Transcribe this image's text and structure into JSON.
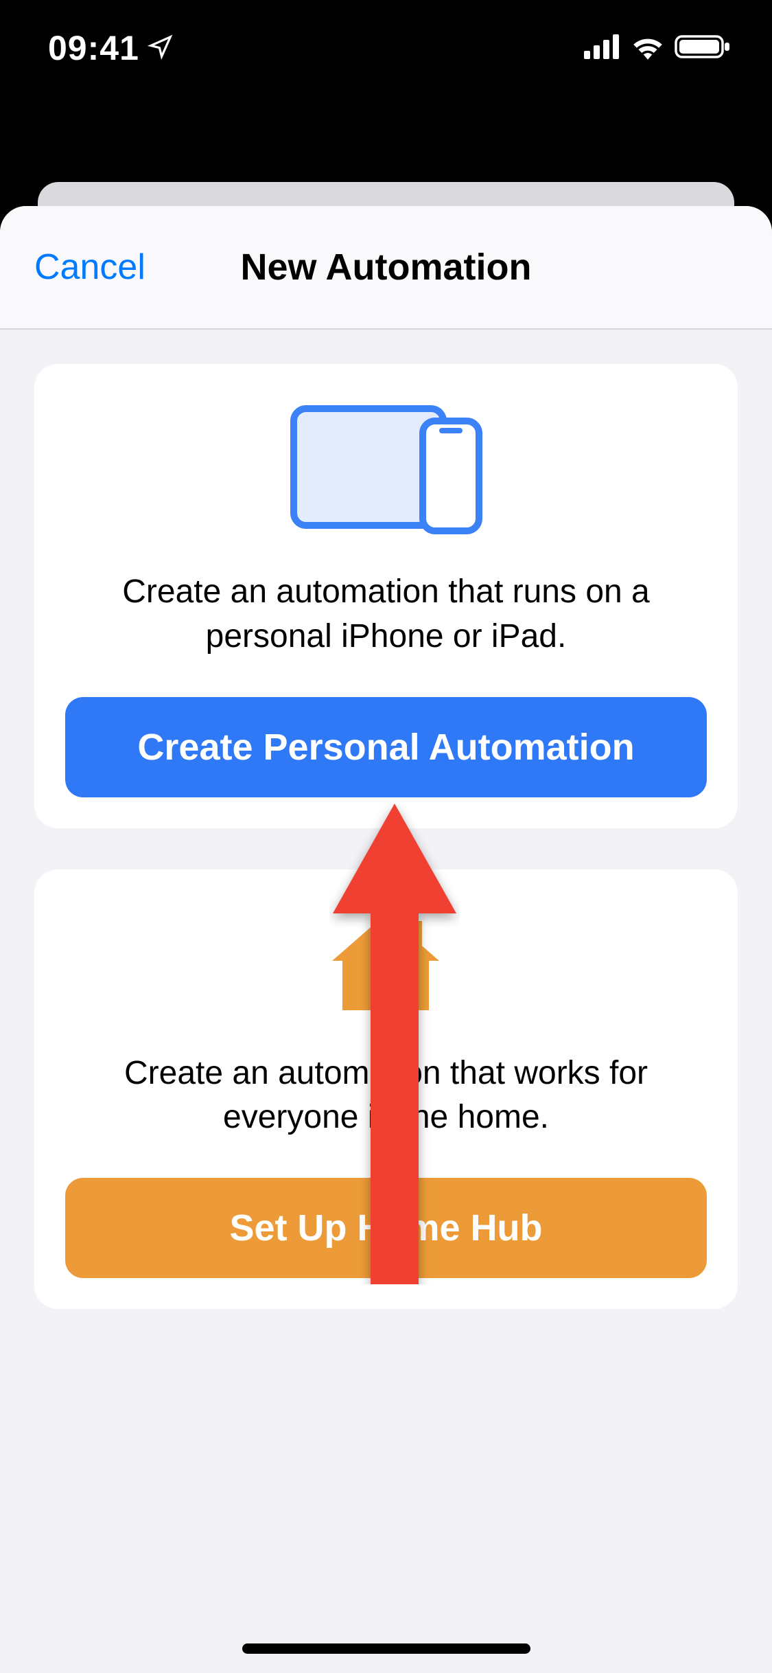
{
  "status_bar": {
    "time": "09:41"
  },
  "sheet": {
    "cancel_label": "Cancel",
    "title": "New Automation"
  },
  "personal": {
    "description": "Create an automation that runs on a personal iPhone or iPad.",
    "button_label": "Create Personal Automation"
  },
  "home": {
    "description": "Create an automation that works for everyone in the home.",
    "button_label": "Set Up Home Hub"
  },
  "colors": {
    "accent_blue": "#2f79f6",
    "accent_orange": "#ed9b38",
    "link_blue": "#007aff"
  }
}
